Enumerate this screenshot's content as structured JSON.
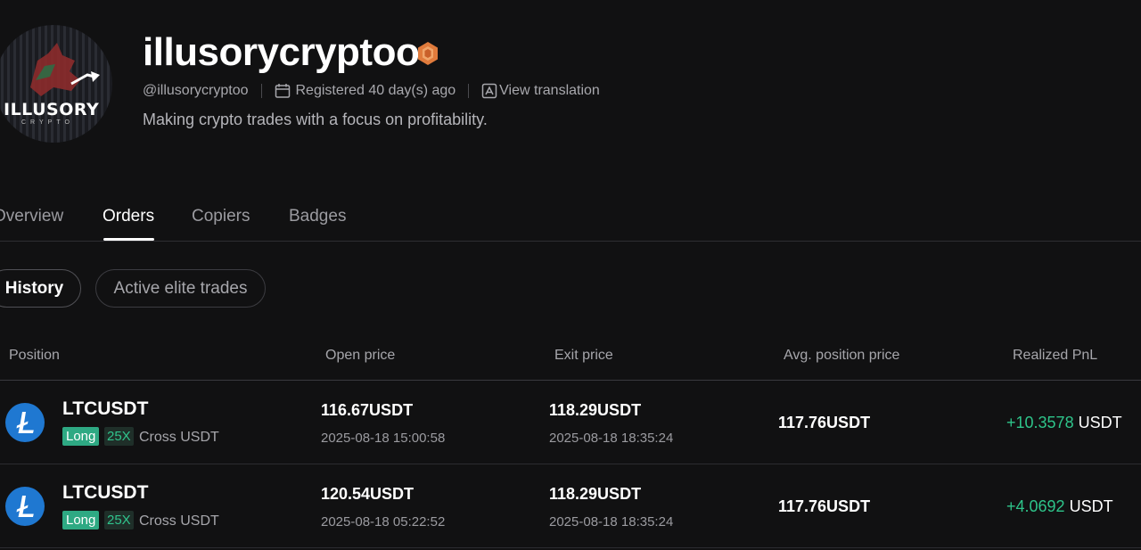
{
  "profile": {
    "avatar_title": "ILLUSORY",
    "avatar_subtitle": "CRYPTO",
    "username": "illusorycryptoo",
    "handle": "@illusorycryptoo",
    "registered": "Registered 40 day(s) ago",
    "view_translation": "View translation",
    "bio": "Making crypto trades with a focus on profitability."
  },
  "tabs": [
    {
      "label": "Overview",
      "active": false
    },
    {
      "label": "Orders",
      "active": true
    },
    {
      "label": "Copiers",
      "active": false
    },
    {
      "label": "Badges",
      "active": false
    }
  ],
  "filters": [
    {
      "label": "History",
      "active": true
    },
    {
      "label": "Active elite trades",
      "active": false
    }
  ],
  "table": {
    "columns": [
      "Position",
      "Open price",
      "Exit price",
      "Avg. position price",
      "Realized PnL"
    ],
    "rows": [
      {
        "symbol": "LTCUSDT",
        "side": "Long",
        "leverage": "25X",
        "margin": "Cross USDT",
        "open_price": "116.67USDT",
        "open_time": "2025-08-18 15:00:58",
        "exit_price": "118.29USDT",
        "exit_time": "2025-08-18 18:35:24",
        "avg_price": "117.76USDT",
        "pnl_value": "+10.3578",
        "pnl_unit": "USDT"
      },
      {
        "symbol": "LTCUSDT",
        "side": "Long",
        "leverage": "25X",
        "margin": "Cross USDT",
        "open_price": "120.54USDT",
        "open_time": "2025-08-18 05:22:52",
        "exit_price": "118.29USDT",
        "exit_time": "2025-08-18 18:35:24",
        "avg_price": "117.76USDT",
        "pnl_value": "+4.0692",
        "pnl_unit": "USDT"
      }
    ]
  },
  "colors": {
    "background": "#111112",
    "profit_green": "#2ec48a",
    "long_tag": "#2ea983",
    "litecoin_blue": "#1f78d1",
    "badge_orange": "#e07b3c"
  },
  "icons": [
    "profile-avatar",
    "badge-icon",
    "calendar-icon",
    "translate-icon",
    "litecoin-icon"
  ]
}
